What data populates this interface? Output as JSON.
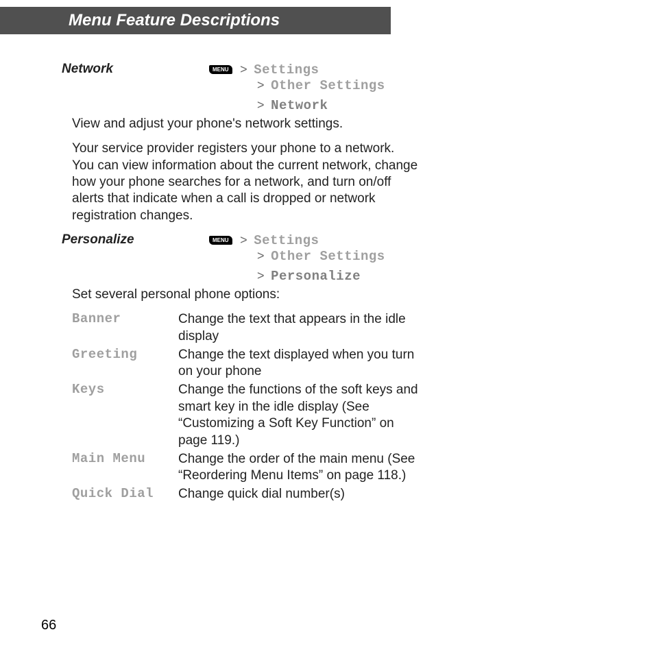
{
  "header": "Menu Feature Descriptions",
  "menu_key": "MENU",
  "gt": ">",
  "nw": {
    "title": "Network",
    "p1": "Settings",
    "p2": "Other Settings",
    "p3": "Network",
    "b1": "View and adjust your phone's network settings.",
    "b2": "Your service provider registers your phone to a network. You can view information about the current network, change how your phone searches for a network, and turn on/off alerts that indicate when a call is dropped or network registration changes."
  },
  "pz": {
    "title": "Personalize",
    "p1": "Settings",
    "p2": "Other Settings",
    "p3": "Personalize",
    "b1": "Set several personal phone options:",
    "opts": [
      {
        "n": "Banner",
        "d": "Change the text that appears in the idle display"
      },
      {
        "n": "Greeting",
        "d": "Change the text displayed when you turn on your phone"
      },
      {
        "n": "Keys",
        "d": "Change the functions of the soft keys and smart key in the idle display (See “Customizing a Soft Key Function” on page 119.)"
      },
      {
        "n": "Main Menu",
        "d": "Change the order of the main menu (See “Reordering Menu Items” on page 118.)"
      },
      {
        "n": "Quick Dial",
        "d": "Change quick dial number(s)"
      }
    ]
  },
  "page_no": "66"
}
